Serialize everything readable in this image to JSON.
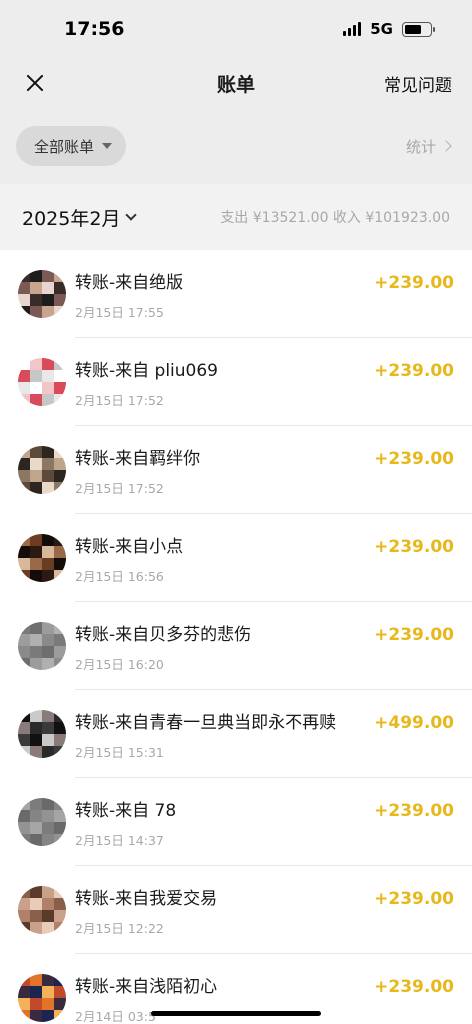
{
  "status_bar": {
    "time": "17:56",
    "network": "5G"
  },
  "nav": {
    "title": "账单",
    "faq_label": "常见问题"
  },
  "filter": {
    "all_bills_label": "全部账单",
    "stats_label": "统计"
  },
  "month": {
    "label": "2025年2月",
    "summary": "支出 ¥13521.00 收入 ¥101923.00"
  },
  "colors": {
    "income_amount": "#e8b81b",
    "background_grey": "#ededed"
  },
  "transactions": [
    {
      "title": "转账-来自绝版",
      "time": "2月15日 17:55",
      "amount": "+239.00"
    },
    {
      "title": "转账-来自 pliu069",
      "time": "2月15日 17:52",
      "amount": "+239.00"
    },
    {
      "title": "转账-来自羁绊你",
      "time": "2月15日 17:52",
      "amount": "+239.00"
    },
    {
      "title": "转账-来自小点",
      "time": "2月15日 16:56",
      "amount": "+239.00"
    },
    {
      "title": "转账-来自贝多芬的悲伤",
      "time": "2月15日 16:20",
      "amount": "+239.00"
    },
    {
      "title": "转账-来自青春一旦典当即永不再赎",
      "time": "2月15日 15:31",
      "amount": "+499.00"
    },
    {
      "title": "转账-来自 78",
      "time": "2月15日 14:37",
      "amount": "+239.00"
    },
    {
      "title": "转账-来自我爱交易",
      "time": "2月15日 12:22",
      "amount": "+239.00"
    },
    {
      "title": "转账-来自浅陌初心",
      "time": "2月14日 03:5",
      "amount": "+239.00"
    }
  ]
}
